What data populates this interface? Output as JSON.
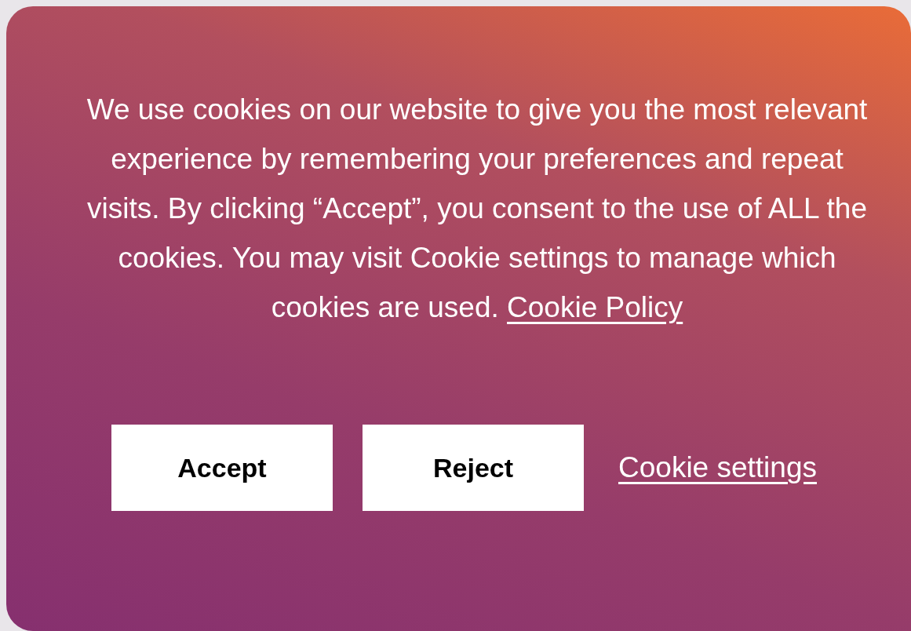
{
  "banner": {
    "message": "We use cookies on our website to give you the most relevant experience by remembering your preferences and repeat visits. By clicking “Accept”, you consent to the use of ALL the cookies. You may visit Cookie settings to manage which cookies are used.",
    "policy_link": "Cookie Policy",
    "buttons": [
      {
        "label": "Accept"
      },
      {
        "label": "Reject"
      }
    ],
    "settings_link": "Cookie settings"
  }
}
